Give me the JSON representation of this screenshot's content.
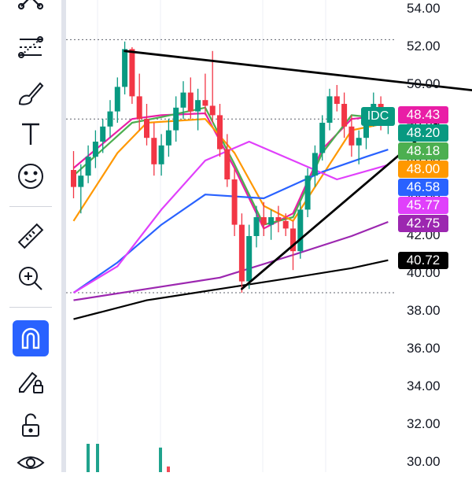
{
  "toolbar": {
    "tools": [
      {
        "icon": "pattern-icon"
      },
      {
        "icon": "fib-retracement-icon"
      },
      {
        "icon": "brush-icon"
      },
      {
        "icon": "text-tool-icon"
      },
      {
        "icon": "emoji-icon"
      },
      {
        "icon": "ruler-icon"
      },
      {
        "icon": "zoom-in-icon"
      },
      {
        "icon": "magnet-icon",
        "active": true
      },
      {
        "icon": "lock-drawing-icon"
      },
      {
        "icon": "unlock-icon"
      },
      {
        "icon": "eye-icon"
      }
    ],
    "active_color": "#2962ff"
  },
  "symbol_tag": {
    "text": "IDC",
    "color": "#089981"
  },
  "chart_data": {
    "type": "candlestick",
    "y_ticks": [
      "54.00",
      "52.00",
      "50.00",
      "48.00",
      "46.00",
      "44.00",
      "42.00",
      "40.00",
      "38.00",
      "36.00",
      "34.00",
      "32.00",
      "30.00"
    ],
    "ylim": [
      29.5,
      54.5
    ],
    "x_range": [
      0,
      90
    ],
    "grid": true,
    "candles": [
      {
        "o": 45.5,
        "h": 46.5,
        "l": 44.0,
        "c": 44.6
      },
      {
        "o": 44.6,
        "h": 45.8,
        "l": 43.2,
        "c": 45.2
      },
      {
        "o": 45.2,
        "h": 46.8,
        "l": 44.8,
        "c": 46.2
      },
      {
        "o": 46.2,
        "h": 47.6,
        "l": 45.6,
        "c": 47.0
      },
      {
        "o": 47.0,
        "h": 48.2,
        "l": 46.4,
        "c": 47.8
      },
      {
        "o": 47.8,
        "h": 49.2,
        "l": 47.2,
        "c": 48.6
      },
      {
        "o": 48.6,
        "h": 50.4,
        "l": 48.0,
        "c": 49.9
      },
      {
        "o": 49.9,
        "h": 52.3,
        "l": 49.5,
        "c": 51.9
      },
      {
        "o": 51.9,
        "h": 52.0,
        "l": 49.0,
        "c": 49.4
      },
      {
        "o": 49.4,
        "h": 50.6,
        "l": 47.6,
        "c": 48.2
      },
      {
        "o": 48.2,
        "h": 49.0,
        "l": 46.8,
        "c": 47.2
      },
      {
        "o": 47.2,
        "h": 48.0,
        "l": 45.2,
        "c": 45.8
      },
      {
        "o": 45.8,
        "h": 47.4,
        "l": 45.2,
        "c": 46.8
      },
      {
        "o": 46.8,
        "h": 48.2,
        "l": 46.2,
        "c": 47.6
      },
      {
        "o": 47.6,
        "h": 49.4,
        "l": 47.0,
        "c": 48.8
      },
      {
        "o": 48.8,
        "h": 50.2,
        "l": 48.2,
        "c": 49.6
      },
      {
        "o": 49.6,
        "h": 50.4,
        "l": 48.2,
        "c": 48.6
      },
      {
        "o": 48.6,
        "h": 49.8,
        "l": 47.6,
        "c": 49.2
      },
      {
        "o": 49.2,
        "h": 50.6,
        "l": 48.4,
        "c": 48.9
      },
      {
        "o": 48.9,
        "h": 51.8,
        "l": 48.0,
        "c": 48.4
      },
      {
        "o": 48.4,
        "h": 49.0,
        "l": 46.2,
        "c": 46.6
      },
      {
        "o": 46.6,
        "h": 47.4,
        "l": 44.6,
        "c": 45.0
      },
      {
        "o": 45.0,
        "h": 45.6,
        "l": 42.0,
        "c": 42.6
      },
      {
        "o": 42.6,
        "h": 43.2,
        "l": 39.0,
        "c": 39.6
      },
      {
        "o": 39.6,
        "h": 42.6,
        "l": 39.2,
        "c": 42.0
      },
      {
        "o": 42.0,
        "h": 43.6,
        "l": 41.4,
        "c": 43.0
      },
      {
        "o": 43.0,
        "h": 43.8,
        "l": 42.0,
        "c": 42.6
      },
      {
        "o": 42.6,
        "h": 43.4,
        "l": 41.8,
        "c": 43.0
      },
      {
        "o": 43.0,
        "h": 43.6,
        "l": 42.2,
        "c": 42.8
      },
      {
        "o": 42.8,
        "h": 43.2,
        "l": 42.0,
        "c": 42.4
      },
      {
        "o": 42.4,
        "h": 42.8,
        "l": 40.2,
        "c": 41.2
      },
      {
        "o": 41.2,
        "h": 43.8,
        "l": 40.8,
        "c": 43.4
      },
      {
        "o": 43.4,
        "h": 45.6,
        "l": 43.0,
        "c": 45.2
      },
      {
        "o": 45.2,
        "h": 46.8,
        "l": 44.6,
        "c": 46.4
      },
      {
        "o": 46.4,
        "h": 48.4,
        "l": 46.0,
        "c": 48.0
      },
      {
        "o": 48.0,
        "h": 49.8,
        "l": 47.6,
        "c": 49.4
      },
      {
        "o": 49.4,
        "h": 50.0,
        "l": 48.6,
        "c": 49.0
      },
      {
        "o": 49.0,
        "h": 49.6,
        "l": 47.2,
        "c": 47.8
      },
      {
        "o": 47.8,
        "h": 48.4,
        "l": 46.2,
        "c": 46.8
      },
      {
        "o": 46.8,
        "h": 47.6,
        "l": 45.8,
        "c": 47.2
      },
      {
        "o": 47.2,
        "h": 48.6,
        "l": 46.6,
        "c": 48.2
      },
      {
        "o": 48.2,
        "h": 49.6,
        "l": 47.8,
        "c": 49.0
      },
      {
        "o": 49.0,
        "h": 49.4,
        "l": 47.6,
        "c": 48.0
      },
      {
        "o": 48.0,
        "h": 48.6,
        "l": 47.4,
        "c": 48.2
      }
    ],
    "moving_averages": [
      {
        "color": "#e91ea6",
        "last": 48.43,
        "points": [
          [
            0,
            45.6
          ],
          [
            8,
            48.2
          ],
          [
            12,
            48.4
          ],
          [
            18,
            48.5
          ],
          [
            22,
            45.6
          ],
          [
            26,
            42.4
          ],
          [
            30,
            43.2
          ],
          [
            34,
            46.6
          ],
          [
            38,
            48.2
          ],
          [
            43,
            48.4
          ]
        ]
      },
      {
        "color": "#4caf50",
        "last": 48.18,
        "points": [
          [
            0,
            45.2
          ],
          [
            8,
            48.0
          ],
          [
            12,
            48.3
          ],
          [
            18,
            48.8
          ],
          [
            22,
            45.8
          ],
          [
            26,
            42.6
          ],
          [
            30,
            43.0
          ],
          [
            34,
            46.4
          ],
          [
            38,
            48.4
          ],
          [
            43,
            48.2
          ]
        ]
      },
      {
        "color": "#ff9800",
        "last": 48.0,
        "points": [
          [
            0,
            42.8
          ],
          [
            6,
            46.4
          ],
          [
            10,
            48.0
          ],
          [
            18,
            48.2
          ],
          [
            22,
            46.4
          ],
          [
            26,
            43.6
          ],
          [
            30,
            42.8
          ],
          [
            34,
            45.2
          ],
          [
            38,
            47.6
          ],
          [
            43,
            48.0
          ]
        ]
      },
      {
        "color": "#2962ff",
        "last": 46.58,
        "points": [
          [
            0,
            39.0
          ],
          [
            6,
            40.6
          ],
          [
            12,
            42.6
          ],
          [
            18,
            44.2
          ],
          [
            26,
            44.0
          ],
          [
            34,
            45.4
          ],
          [
            40,
            46.2
          ],
          [
            43,
            46.58
          ]
        ]
      },
      {
        "color": "#e040fb",
        "last": 45.77,
        "points": [
          [
            0,
            39.0
          ],
          [
            6,
            40.4
          ],
          [
            12,
            43.4
          ],
          [
            18,
            46.0
          ],
          [
            24,
            47.0
          ],
          [
            30,
            46.0
          ],
          [
            36,
            45.0
          ],
          [
            43,
            45.77
          ]
        ]
      },
      {
        "color": "#9c27b0",
        "last": 42.75,
        "points": [
          [
            0,
            38.6
          ],
          [
            10,
            39.2
          ],
          [
            20,
            39.8
          ],
          [
            30,
            41.0
          ],
          [
            38,
            42.0
          ],
          [
            43,
            42.75
          ]
        ]
      },
      {
        "color": "#000000",
        "last": 40.72,
        "points": [
          [
            0,
            37.6
          ],
          [
            10,
            38.6
          ],
          [
            20,
            39.2
          ],
          [
            30,
            39.8
          ],
          [
            38,
            40.3
          ],
          [
            43,
            40.72
          ]
        ]
      }
    ],
    "trendlines": [
      {
        "from": [
          7,
          51.8
        ],
        "to": [
          55,
          49.7
        ]
      },
      {
        "from": [
          23,
          39.2
        ],
        "to": [
          50,
          48.1
        ]
      }
    ],
    "horizontal_levels": [
      52.4,
      48.2,
      39.0
    ],
    "price_tags": [
      {
        "text": "48.43",
        "color": "#e91ea6"
      },
      {
        "text": "48.20",
        "color": "#089981"
      },
      {
        "text": "48.18",
        "color": "#4caf50"
      },
      {
        "text": "48.00",
        "color": "#ff9800"
      },
      {
        "text": "46.58",
        "color": "#2962ff"
      },
      {
        "text": "45.77",
        "color": "#e040fb"
      },
      {
        "text": "42.75",
        "color": "#9c27b0"
      },
      {
        "text": "40.72",
        "color": "#000000"
      }
    ],
    "up_color": "#089981",
    "down_color": "#f23645"
  }
}
